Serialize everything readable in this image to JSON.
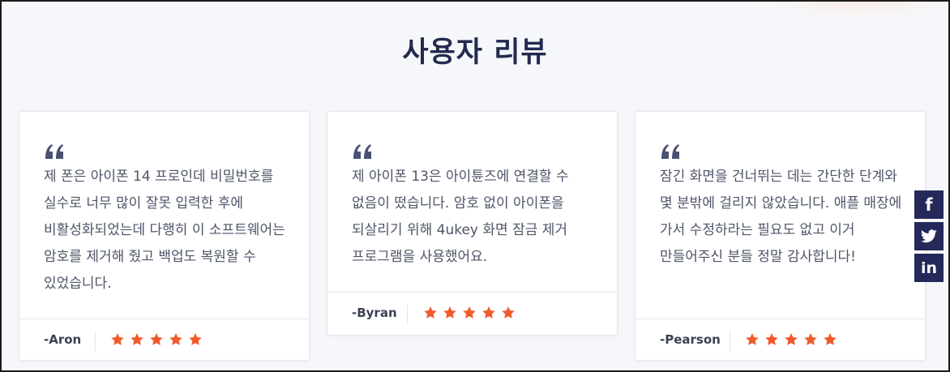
{
  "section": {
    "title": "사용자 리뷰"
  },
  "reviews": [
    {
      "text": "제 폰은 아이폰 14 프로인데 비밀번호를 실수로 너무 많이 잘못 입력한 후에 비활성화되었는데 다행히 이 소프트웨어는 암호를 제거해 줬고 백업도 복원할 수 있었습니다.",
      "author": "-Aron",
      "rating": 5
    },
    {
      "text": "제 아이폰 13은 아이튠즈에 연결할 수 없음이 떴습니다. 암호 없이 아이폰을 되살리기 위해 4ukey 화면 잠금 제거 프로그램을 사용했어요.",
      "author": "-Byran",
      "rating": 5
    },
    {
      "text": "잠긴 화면을 건너뛰는 데는 간단한 단계와 몇 분밖에 걸리지 않았습니다. 애플 매장에 가서 수정하라는 필요도 없고 이거 만들어주신 분들 정말 감사합니다!",
      "author": "-Pearson",
      "rating": 5
    }
  ],
  "social": [
    {
      "icon": "facebook-icon",
      "glyph": "f"
    },
    {
      "icon": "twitter-icon",
      "glyph": ""
    },
    {
      "icon": "linkedin-icon",
      "glyph": "in"
    }
  ],
  "colors": {
    "title": "#232a4f",
    "star": "#f15a2b",
    "quote": "#4a5173",
    "social_bg": "#25295a"
  }
}
